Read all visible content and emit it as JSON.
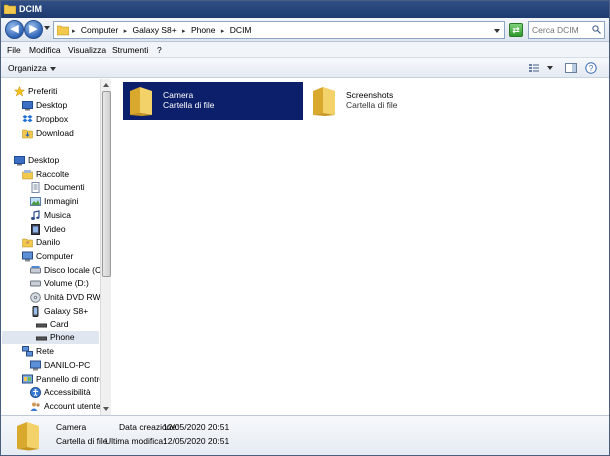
{
  "window": {
    "title": "DCIM"
  },
  "address": {
    "crumbs": [
      "Computer",
      "Galaxy S8+",
      "Phone",
      "DCIM"
    ],
    "separator": "▸"
  },
  "search": {
    "placeholder": "Cerca DCIM"
  },
  "menu": [
    "File",
    "Modifica",
    "Visualizza",
    "Strumenti",
    "?"
  ],
  "toolbar": {
    "organize_label": "Organizza"
  },
  "nav": {
    "favorites": {
      "label": "Preferiti",
      "items": [
        "Desktop",
        "Dropbox",
        "Download"
      ]
    },
    "desktop": "Desktop",
    "libraries": {
      "label": "Raccolte",
      "items": [
        "Documenti",
        "Immagini",
        "Musica",
        "Video"
      ]
    },
    "user": "Danilo",
    "computer": {
      "label": "Computer",
      "items": [
        "Disco locale (C:)",
        "Volume (D:)",
        "Unità DVD RW (E",
        "Galaxy S8+"
      ],
      "device_children": [
        "Card",
        "Phone"
      ]
    },
    "network": {
      "label": "Rete",
      "items": [
        "DANILO-PC"
      ]
    },
    "control_panel": {
      "label": "Pannello di control",
      "items": [
        "Accessibilità",
        "Account utente"
      ]
    }
  },
  "files": [
    {
      "name": "Camera",
      "type": "Cartella di file",
      "selected": true
    },
    {
      "name": "Screenshots",
      "type": "Cartella di file",
      "selected": false
    }
  ],
  "details": {
    "name": "Camera",
    "type": "Cartella di file",
    "created_label": "Data creazione:",
    "created_value": "12/05/2020 20:51",
    "modified_label": "Ultima modifica:",
    "modified_value": "12/05/2020 20:51"
  },
  "colors": {
    "selection": "#0c1f6a",
    "titlebar": "#2f4f86",
    "folder": "#f2c94c"
  }
}
